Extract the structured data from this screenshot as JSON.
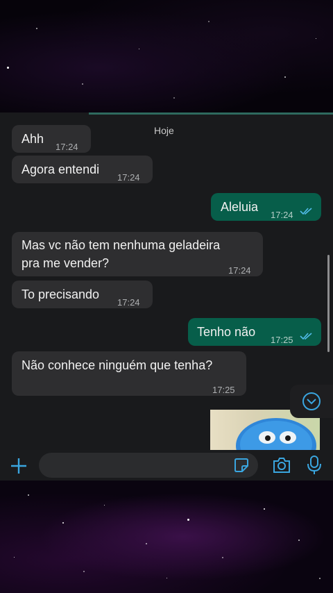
{
  "chat": {
    "date_chip": "Hoje",
    "messages": [
      {
        "text": "Ahh",
        "time": "17:24"
      },
      {
        "text": "Agora entendi",
        "time": "17:24"
      },
      {
        "text": "Aleluia",
        "time": "17:24"
      },
      {
        "text_line1": "Mas vc não tem nenhuma geladeira",
        "text_line2": "pra me vender?",
        "time": "17:24"
      },
      {
        "text": "To precisando",
        "time": "17:24"
      },
      {
        "text": "Tenho não",
        "time": "17:25"
      },
      {
        "text": "Não conhece ninguém que tenha?",
        "time": "17:25"
      }
    ]
  },
  "colors": {
    "incoming_bubble": "#2e2e30",
    "outgoing_bubble": "#075e4a",
    "read_ticks": "#53bdeb",
    "accent": "#3aa6e0"
  },
  "icons": {
    "attach": "plus-icon",
    "sticker": "sticker-icon",
    "camera": "camera-icon",
    "mic": "microphone-icon",
    "scroll": "chevron-down-icon"
  }
}
